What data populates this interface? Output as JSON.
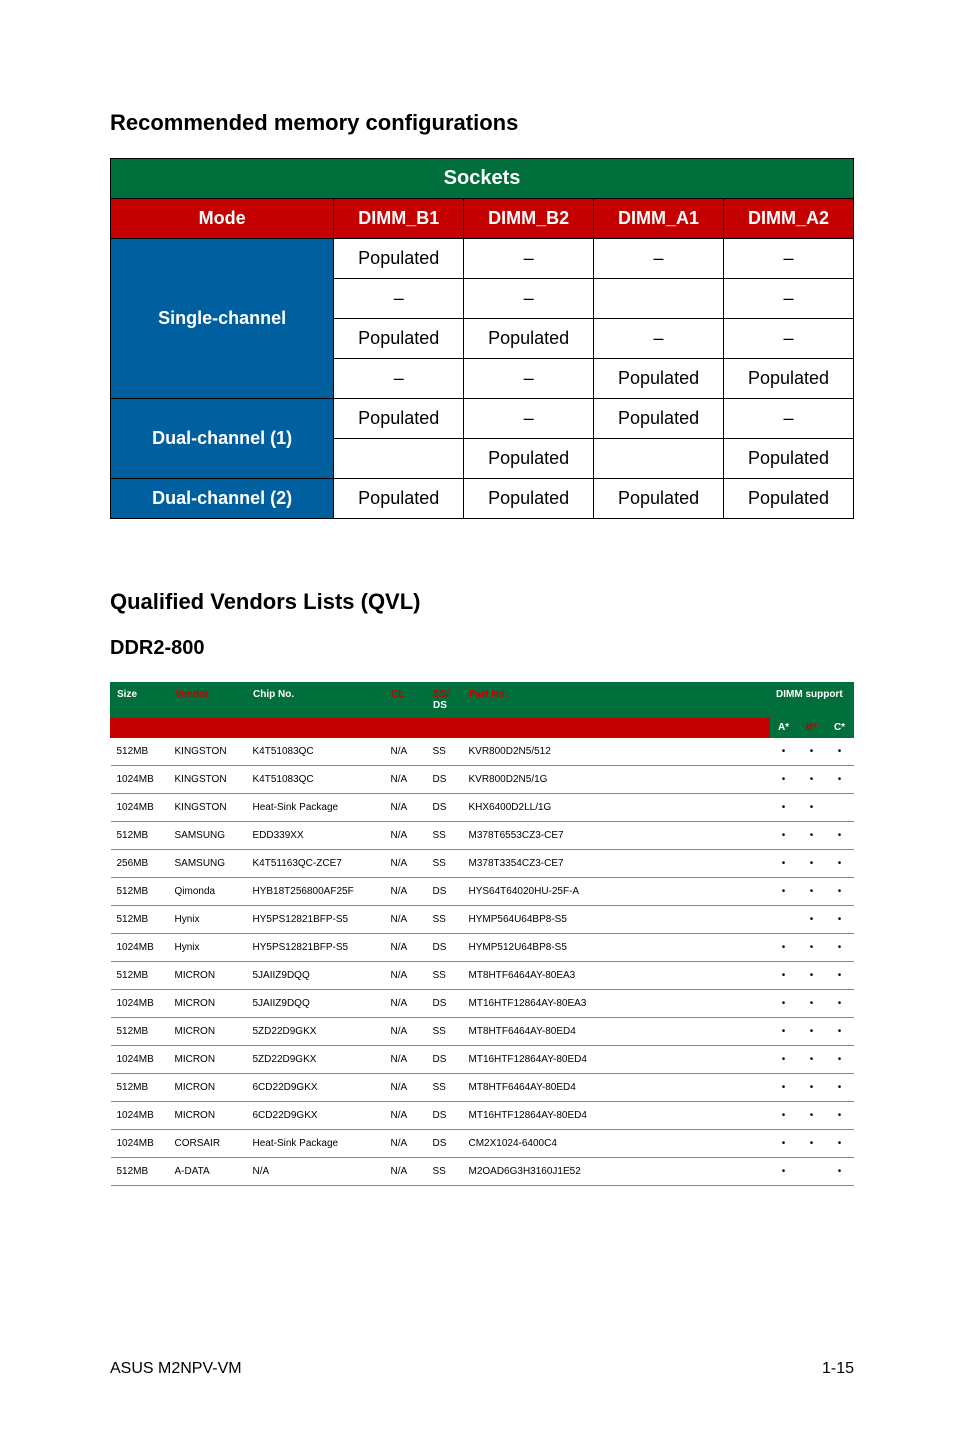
{
  "headings": {
    "rec_mem": "Recommended memory configurations",
    "qvl": "Qualified Vendors Lists (QVL)",
    "ddr2": "DDR2-800"
  },
  "sockets": {
    "title": "Sockets",
    "mode_label": "Mode",
    "cols": [
      "DIMM_B1",
      "DIMM_B2",
      "DIMM_A1",
      "DIMM_A2"
    ],
    "single_label": "Single-channel",
    "dual1_label": "Dual-channel (1)",
    "dual2_label": "Dual-channel (2)",
    "rows": {
      "sc1": [
        "Populated",
        "–",
        "–",
        "–"
      ],
      "sc2": [
        "–",
        "–",
        "",
        "–"
      ],
      "sc3": [
        "Populated",
        "Populated",
        "–",
        "–"
      ],
      "sc4": [
        "–",
        "–",
        "Populated",
        "Populated"
      ],
      "d1a": [
        "Populated",
        "–",
        "Populated",
        "–"
      ],
      "d1b": [
        "",
        "Populated",
        "",
        "Populated"
      ],
      "d2": [
        "Populated",
        "Populated",
        "Populated",
        "Populated"
      ]
    }
  },
  "qvl_table": {
    "headers": {
      "size": "Size",
      "vendor": "Vendor",
      "chip": "Chip No.",
      "cl": "CL",
      "ssds_ss": "SS/",
      "ssds_ds": "DS",
      "part": "Part No.",
      "dimm": "DIMM support",
      "a": "A*",
      "b": "B*",
      "c": "C*"
    },
    "rows": [
      {
        "size": "512MB",
        "vendor": "KINGSTON",
        "chip": "K4T51083QC",
        "cl": "N/A",
        "ssds": "SS",
        "part": "KVR800D2N5/512",
        "a": "•",
        "b": "•",
        "c": "•"
      },
      {
        "size": "1024MB",
        "vendor": "KINGSTON",
        "chip": "K4T51083QC",
        "cl": "N/A",
        "ssds": "DS",
        "part": "KVR800D2N5/1G",
        "a": "•",
        "b": "•",
        "c": "•"
      },
      {
        "size": "1024MB",
        "vendor": "KINGSTON",
        "chip": "Heat-Sink Package",
        "cl": "N/A",
        "ssds": "DS",
        "part": "KHX6400D2LL/1G",
        "a": "•",
        "b": "•",
        "c": ""
      },
      {
        "size": "512MB",
        "vendor": "SAMSUNG",
        "chip": "EDD339XX",
        "cl": "N/A",
        "ssds": "SS",
        "part": "M378T6553CZ3-CE7",
        "a": "•",
        "b": "•",
        "c": "•"
      },
      {
        "size": "256MB",
        "vendor": "SAMSUNG",
        "chip": "K4T51163QC-ZCE7",
        "cl": "N/A",
        "ssds": "SS",
        "part": "M378T3354CZ3-CE7",
        "a": "•",
        "b": "•",
        "c": "•"
      },
      {
        "size": "512MB",
        "vendor": "Qimonda",
        "chip": "HYB18T256800AF25F",
        "cl": "N/A",
        "ssds": "DS",
        "part": "HYS64T64020HU-25F-A",
        "a": "•",
        "b": "•",
        "c": "•"
      },
      {
        "size": "512MB",
        "vendor": "Hynix",
        "chip": "HY5PS12821BFP-S5",
        "cl": "N/A",
        "ssds": "SS",
        "part": "HYMP564U64BP8-S5",
        "a": "",
        "b": "•",
        "c": "•"
      },
      {
        "size": "1024MB",
        "vendor": "Hynix",
        "chip": "HY5PS12821BFP-S5",
        "cl": "N/A",
        "ssds": "DS",
        "part": "HYMP512U64BP8-S5",
        "a": "•",
        "b": "•",
        "c": "•"
      },
      {
        "size": "512MB",
        "vendor": "MICRON",
        "chip": "5JAIIZ9DQQ",
        "cl": "N/A",
        "ssds": "SS",
        "part": "MT8HTF6464AY-80EA3",
        "a": "•",
        "b": "•",
        "c": "•"
      },
      {
        "size": "1024MB",
        "vendor": "MICRON",
        "chip": "5JAIIZ9DQQ",
        "cl": "N/A",
        "ssds": "DS",
        "part": "MT16HTF12864AY-80EA3",
        "a": "•",
        "b": "•",
        "c": "•"
      },
      {
        "size": "512MB",
        "vendor": "MICRON",
        "chip": "5ZD22D9GKX",
        "cl": "N/A",
        "ssds": "SS",
        "part": "MT8HTF6464AY-80ED4",
        "a": "•",
        "b": "•",
        "c": "•"
      },
      {
        "size": "1024MB",
        "vendor": "MICRON",
        "chip": "5ZD22D9GKX",
        "cl": "N/A",
        "ssds": "DS",
        "part": "MT16HTF12864AY-80ED4",
        "a": "•",
        "b": "•",
        "c": "•"
      },
      {
        "size": "512MB",
        "vendor": "MICRON",
        "chip": "6CD22D9GKX",
        "cl": "N/A",
        "ssds": "SS",
        "part": "MT8HTF6464AY-80ED4",
        "a": "•",
        "b": "•",
        "c": "•"
      },
      {
        "size": "1024MB",
        "vendor": "MICRON",
        "chip": "6CD22D9GKX",
        "cl": "N/A",
        "ssds": "DS",
        "part": "MT16HTF12864AY-80ED4",
        "a": "•",
        "b": "•",
        "c": "•"
      },
      {
        "size": "1024MB",
        "vendor": "CORSAIR",
        "chip": "Heat-Sink Package",
        "cl": "N/A",
        "ssds": "DS",
        "part": "CM2X1024-6400C4",
        "a": "•",
        "b": "•",
        "c": "•"
      },
      {
        "size": "512MB",
        "vendor": "A-DATA",
        "chip": "N/A",
        "cl": "N/A",
        "ssds": "SS",
        "part": "M2OAD6G3H3160J1E52",
        "a": "•",
        "b": "",
        "c": "•"
      }
    ]
  },
  "footer": {
    "left": "ASUS M2NPV-VM",
    "right": "1-15"
  }
}
